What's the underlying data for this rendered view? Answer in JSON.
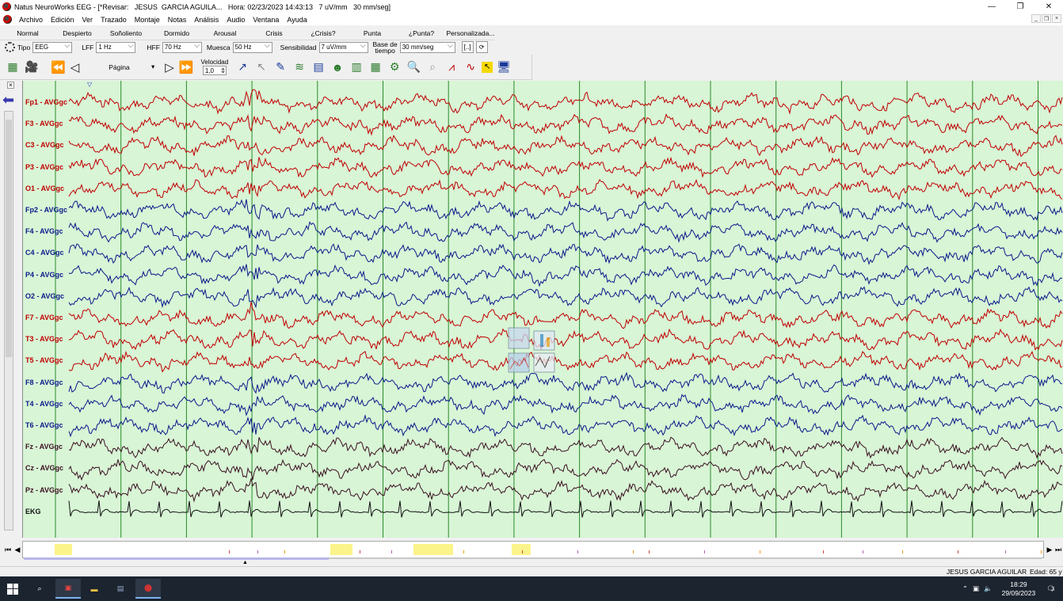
{
  "window": {
    "title": "Natus NeuroWorks EEG - [*Revisar:   JESUS  GARCIA AGUILA...   Hora: 02/23/2023 14:43:13   7 uV/mm   30 mm/seg]"
  },
  "menu": [
    "Archivo",
    "Edición",
    "Ver",
    "Trazado",
    "Montaje",
    "Notas",
    "Análisis",
    "Audio",
    "Ventana",
    "Ayuda"
  ],
  "presets": [
    "Normal",
    "Despierto",
    "Soñoliento",
    "Dormido",
    "Arousal",
    "Crisis",
    "¿Crisis?",
    "Punta",
    "¿Punta?",
    "Personalizada..."
  ],
  "settings": {
    "tipo_label": "Tipo",
    "tipo_value": "EEG",
    "lff_label": "LFF",
    "lff_value": "1 Hz",
    "hff_label": "HFF",
    "hff_value": "70 Hz",
    "muesca_label": "Muesca",
    "muesca_value": "50 Hz",
    "sensibilidad_label": "Sensibilidad",
    "sensibilidad_value": "7 uV/mm",
    "base_label_1": "Base de",
    "base_label_2": "tiempo",
    "base_value": "30 mm/seg",
    "bracket_btn": "[..]"
  },
  "toolbar": {
    "pagina_label": "Página",
    "velocidad_label": "Velocidad",
    "velocidad_value": "1,0"
  },
  "channels": [
    {
      "name": "Fp1 - AVGgc",
      "color": "#c00000"
    },
    {
      "name": "F3 - AVGgc",
      "color": "#c00000"
    },
    {
      "name": "C3 - AVGgc",
      "color": "#c00000"
    },
    {
      "name": "P3 - AVGgc",
      "color": "#c00000"
    },
    {
      "name": "O1 - AVGgc",
      "color": "#c00000"
    },
    {
      "name": "Fp2 - AVGgc",
      "color": "#0a1a8a"
    },
    {
      "name": "F4 - AVGgc",
      "color": "#0a1a8a"
    },
    {
      "name": "C4 - AVGgc",
      "color": "#0a1a8a"
    },
    {
      "name": "P4 - AVGgc",
      "color": "#0a1a8a"
    },
    {
      "name": "O2 - AVGgc",
      "color": "#0a1a8a"
    },
    {
      "name": "F7 - AVGgc",
      "color": "#c00000"
    },
    {
      "name": "T3 - AVGgc",
      "color": "#c00000"
    },
    {
      "name": "T5 - AVGgc",
      "color": "#c00000"
    },
    {
      "name": "F8 - AVGgc",
      "color": "#0a1a8a"
    },
    {
      "name": "T4 - AVGgc",
      "color": "#0a1a8a"
    },
    {
      "name": "T6 - AVGgc",
      "color": "#0a1a8a"
    },
    {
      "name": "Fz - AVGgc",
      "color": "#3a1020"
    },
    {
      "name": "Cz - AVGgc",
      "color": "#3a1020"
    },
    {
      "name": "Pz - AVGgc",
      "color": "#3a1020"
    },
    {
      "name": "EKG",
      "color": "#111111"
    }
  ],
  "colors": {
    "background": "#d8f5d6",
    "gridline": "#2a8a2a",
    "highlight": "#fbf48a"
  },
  "status": {
    "patient": "JESUS  GARCIA AGUILAR",
    "age": "Edad: 65 y"
  },
  "taskbar": {
    "time": "18:29",
    "date": "29/09/2023",
    "notifications": "3"
  }
}
